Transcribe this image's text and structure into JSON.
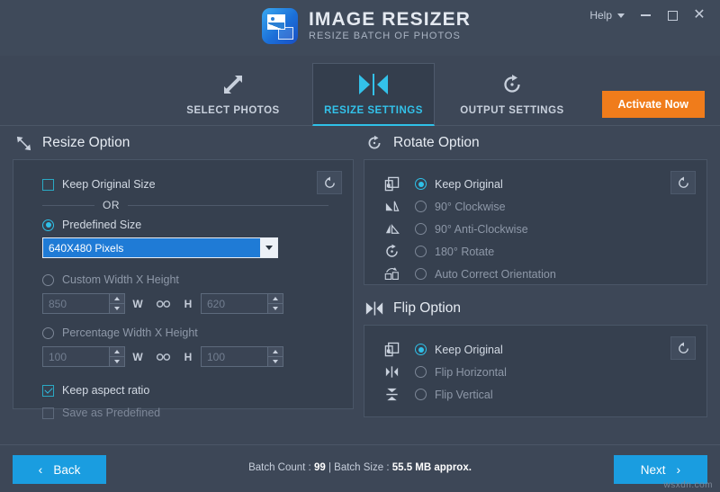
{
  "titlebar": {
    "app_name": "IMAGE RESIZER",
    "tagline": "RESIZE BATCH OF PHOTOS",
    "logo_icon": "image-resizer-logo",
    "help_label": "Help",
    "minimize_icon": "minimize-icon",
    "maximize_icon": "maximize-icon",
    "close_icon": "close-icon"
  },
  "tabs": [
    {
      "label": "SELECT PHOTOS",
      "icon": "expand-arrows-icon",
      "active": false
    },
    {
      "label": "RESIZE SETTINGS",
      "icon": "resize-bowtie-icon",
      "active": true
    },
    {
      "label": "OUTPUT SETTINGS",
      "icon": "rotate-cw-icon",
      "active": false
    }
  ],
  "activate_button": {
    "label": "Activate Now",
    "color": "#f07c1b"
  },
  "resize_section": {
    "title": "Resize Option",
    "icon": "diagonal-resize-icon",
    "reset_icon": "reset-icon",
    "keep_original_size": {
      "label": "Keep Original Size",
      "checked": false
    },
    "or_label": "OR",
    "predefined_size": {
      "label": "Predefined Size",
      "selected": true
    },
    "predefined_dropdown": {
      "value": "640X480 Pixels",
      "arrow_icon": "chevron-down-icon"
    },
    "custom_wh": {
      "label": "Custom Width X Height",
      "selected": false,
      "width_value": "850",
      "height_value": "620",
      "w_label": "W",
      "h_label": "H",
      "link_icon": "chain-link-icon"
    },
    "percentage_wh": {
      "label": "Percentage Width X Height",
      "selected": false,
      "width_value": "100",
      "height_value": "100",
      "w_label": "W",
      "h_label": "H",
      "link_icon": "chain-link-icon"
    },
    "keep_aspect_ratio": {
      "label": "Keep aspect ratio",
      "checked": true
    },
    "save_as_predefined": {
      "label": "Save as Predefined",
      "checked": false,
      "disabled": true
    }
  },
  "rotate_section": {
    "title": "Rotate Option",
    "icon": "rotate-cw-icon",
    "reset_icon": "reset-icon",
    "options": [
      {
        "label": "Keep Original",
        "icon": "keep-original-icon",
        "selected": true,
        "disabled": false
      },
      {
        "label": "90° Clockwise",
        "icon": "rotate-90-cw-icon",
        "selected": false,
        "disabled": true
      },
      {
        "label": "90° Anti-Clockwise",
        "icon": "rotate-90-ccw-icon",
        "selected": false,
        "disabled": true
      },
      {
        "label": "180° Rotate",
        "icon": "rotate-180-icon",
        "selected": false,
        "disabled": true
      },
      {
        "label": "Auto Correct Orientation",
        "icon": "auto-orientation-icon",
        "selected": false,
        "disabled": true
      }
    ]
  },
  "flip_section": {
    "title": "Flip Option",
    "icon": "flip-bowtie-icon",
    "reset_icon": "reset-icon",
    "options": [
      {
        "label": "Keep Original",
        "icon": "keep-original-icon",
        "selected": true,
        "disabled": false
      },
      {
        "label": "Flip Horizontal",
        "icon": "flip-horizontal-icon",
        "selected": false,
        "disabled": true
      },
      {
        "label": "Flip Vertical",
        "icon": "flip-vertical-icon",
        "selected": false,
        "disabled": true
      }
    ]
  },
  "footer": {
    "back_label": "Back",
    "next_label": "Next",
    "back_icon": "chevron-left-icon",
    "next_icon": "chevron-right-icon",
    "batch_count_label": "Batch Count :",
    "batch_count_value": "99",
    "separator": "|",
    "batch_size_label": "Batch Size :",
    "batch_size_value": "55.5 MB approx.",
    "watermark": "wsxdn.com"
  }
}
